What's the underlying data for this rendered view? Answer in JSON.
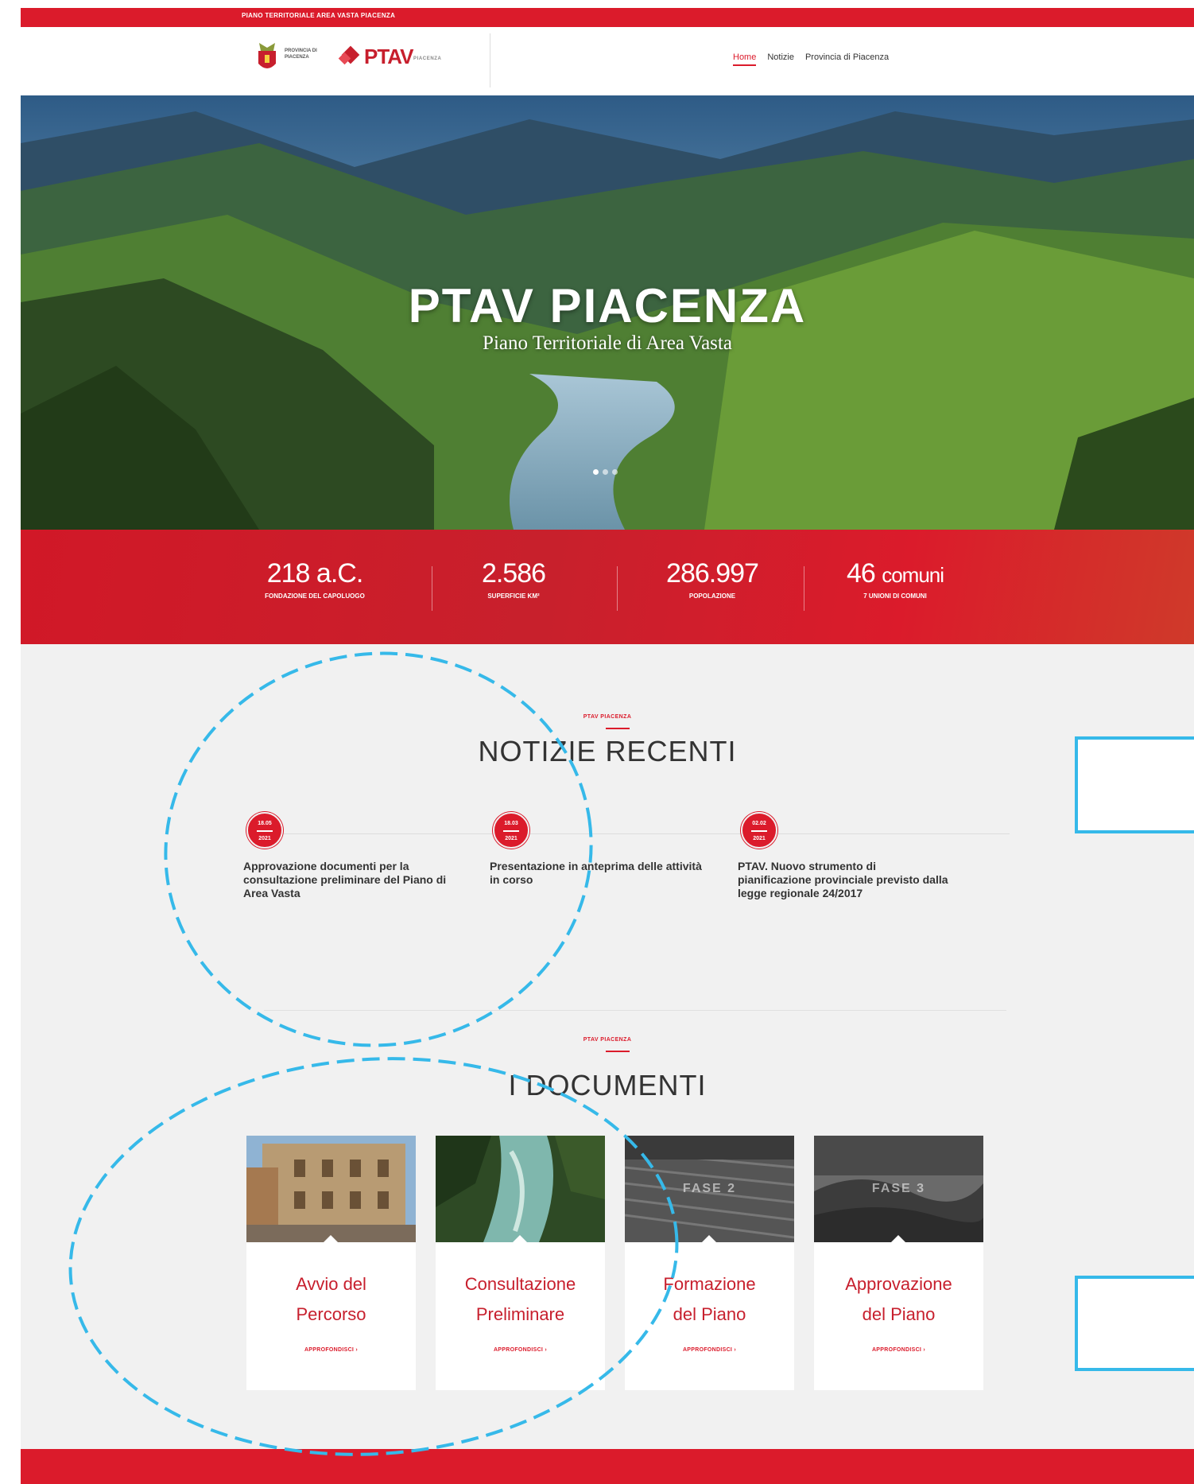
{
  "topbar": {
    "text": "PIANO TERRITORIALE AREA VASTA PIACENZA"
  },
  "header": {
    "logo_provincia_text": "PROVINCIA DI PIACENZA",
    "logo_ptav_text": "PTAV",
    "logo_ptav_sub": "PIACENZA"
  },
  "nav": {
    "items": [
      {
        "label": "Home",
        "active": true
      },
      {
        "label": "Notizie",
        "active": false
      },
      {
        "label": "Provincia di Piacenza",
        "active": false
      }
    ]
  },
  "hero": {
    "title": "PTAV PIACENZA",
    "subtitle": "Piano Territoriale di Area Vasta",
    "slides": 3,
    "active_slide": 1
  },
  "stats": [
    {
      "value": "218 a.C.",
      "label": "FONDAZIONE DEL CAPOLUOGO"
    },
    {
      "value": "2.586",
      "label": "SUPERFICIE KM²"
    },
    {
      "value": "286.997",
      "label": "POPOLAZIONE"
    },
    {
      "value": "46",
      "value_suffix": "comuni",
      "label": "7 UNIONI DI COMUNI"
    }
  ],
  "news_section": {
    "eyebrow": "PTAV PIACENZA",
    "title": "NOTIZIE RECENTI",
    "items": [
      {
        "day": "18.05",
        "year": "2021",
        "text": "Approvazione documenti per la consultazione preliminare del Piano di Area Vasta"
      },
      {
        "day": "18.03",
        "year": "2021",
        "text": "Presentazione in anteprima delle attività in corso"
      },
      {
        "day": "02.02",
        "year": "2021",
        "text": "PTAV. Nuovo strumento di pianificazione provinciale previsto dalla legge regionale 24/2017"
      }
    ]
  },
  "docs_section": {
    "eyebrow": "PTAV PIACENZA",
    "title": "I DOCUMENTI",
    "cards": [
      {
        "title_line1": "Avvio del",
        "title_line2": "Percorso",
        "phase": "",
        "link": "APPROFONDISCI ›"
      },
      {
        "title_line1": "Consultazione",
        "title_line2": "Preliminare",
        "phase": "",
        "link": "APPROFONDISCI ›"
      },
      {
        "title_line1": "Formazione",
        "title_line2": "del Piano",
        "phase": "FASE 2",
        "link": "APPROFONDISCI ›"
      },
      {
        "title_line1": "Approvazione",
        "title_line2": "del Piano",
        "phase": "FASE 3",
        "link": "APPROFONDISCI ›"
      }
    ]
  },
  "colors": {
    "brand_red": "#db1b2b",
    "annotation_blue": "#36b9e9",
    "background": "#f1f1f1"
  }
}
